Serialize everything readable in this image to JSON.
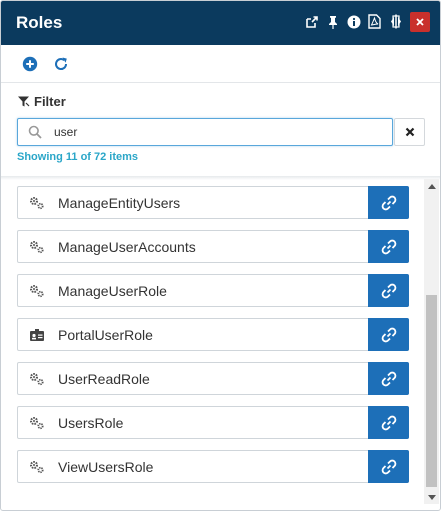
{
  "window": {
    "title": "Roles",
    "header_icons": [
      "popout-icon",
      "pin-icon",
      "info-icon",
      "pdf-icon",
      "resize-icon",
      "close-icon"
    ],
    "close_color": "#c9302c",
    "header_color": "#0b3a5e"
  },
  "toolbar": {
    "buttons": [
      "add-circle-icon",
      "refresh-icon"
    ]
  },
  "filter": {
    "label": "Filter",
    "search_value": "user",
    "count_text": "Showing 11 of 72 items"
  },
  "roles": [
    {
      "name": "ManageEntityUsers",
      "icon": "cogs-icon"
    },
    {
      "name": "ManageUserAccounts",
      "icon": "cogs-icon"
    },
    {
      "name": "ManageUserRole",
      "icon": "cogs-icon"
    },
    {
      "name": "PortalUserRole",
      "icon": "id-card-icon"
    },
    {
      "name": "UserReadRole",
      "icon": "cogs-icon"
    },
    {
      "name": "UsersRole",
      "icon": "cogs-icon"
    },
    {
      "name": "ViewUsersRole",
      "icon": "cogs-icon"
    }
  ],
  "accent": "#1d6fb8",
  "count_color": "#2aa6c8"
}
